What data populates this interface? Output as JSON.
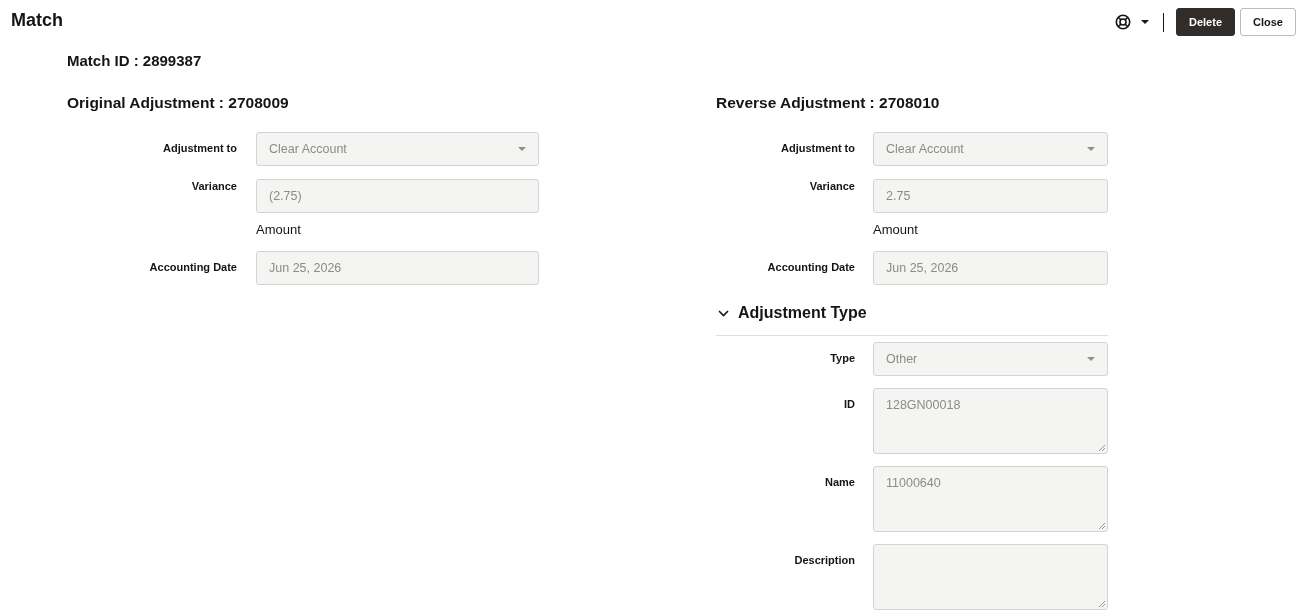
{
  "header": {
    "title": "Match",
    "buttons": [
      {
        "label": "Delete",
        "kind": "primary"
      },
      {
        "label": "Close",
        "kind": "secondary"
      }
    ]
  },
  "match_id": "Match ID : 2899387",
  "panels": [
    {
      "title": "Original Adjustment : 2708009",
      "fields": [
        {
          "label": "Adjustment to",
          "kind": "select",
          "value": "Clear Account",
          "disabled": true
        },
        {
          "label": "Variance",
          "kind": "amount",
          "value": "(2.75)",
          "caption": "Amount",
          "disabled": true
        },
        {
          "label": "Accounting Date",
          "kind": "text",
          "value": "Jun 25, 2026",
          "disabled": true
        }
      ]
    },
    {
      "title": "Reverse Adjustment : 2708010",
      "fields": [
        {
          "label": "Adjustment to",
          "kind": "select",
          "value": "Clear Account",
          "disabled": true
        },
        {
          "label": "Variance",
          "kind": "amount",
          "value": "2.75",
          "caption": "Amount",
          "disabled": true
        },
        {
          "label": "Accounting Date",
          "kind": "text",
          "value": "Jun 25, 2026",
          "disabled": true
        }
      ],
      "section": {
        "title": "Adjustment Type",
        "expanded": true,
        "fields": [
          {
            "label": "Type",
            "kind": "select",
            "value": "Other",
            "disabled": true
          },
          {
            "label": "ID",
            "kind": "textarea",
            "value": "128GN00018",
            "disabled": true
          },
          {
            "label": "Name",
            "kind": "textarea",
            "value": "11000640",
            "disabled": true
          },
          {
            "label": "Description",
            "kind": "textarea",
            "disabled": true
          }
        ]
      }
    }
  ]
}
